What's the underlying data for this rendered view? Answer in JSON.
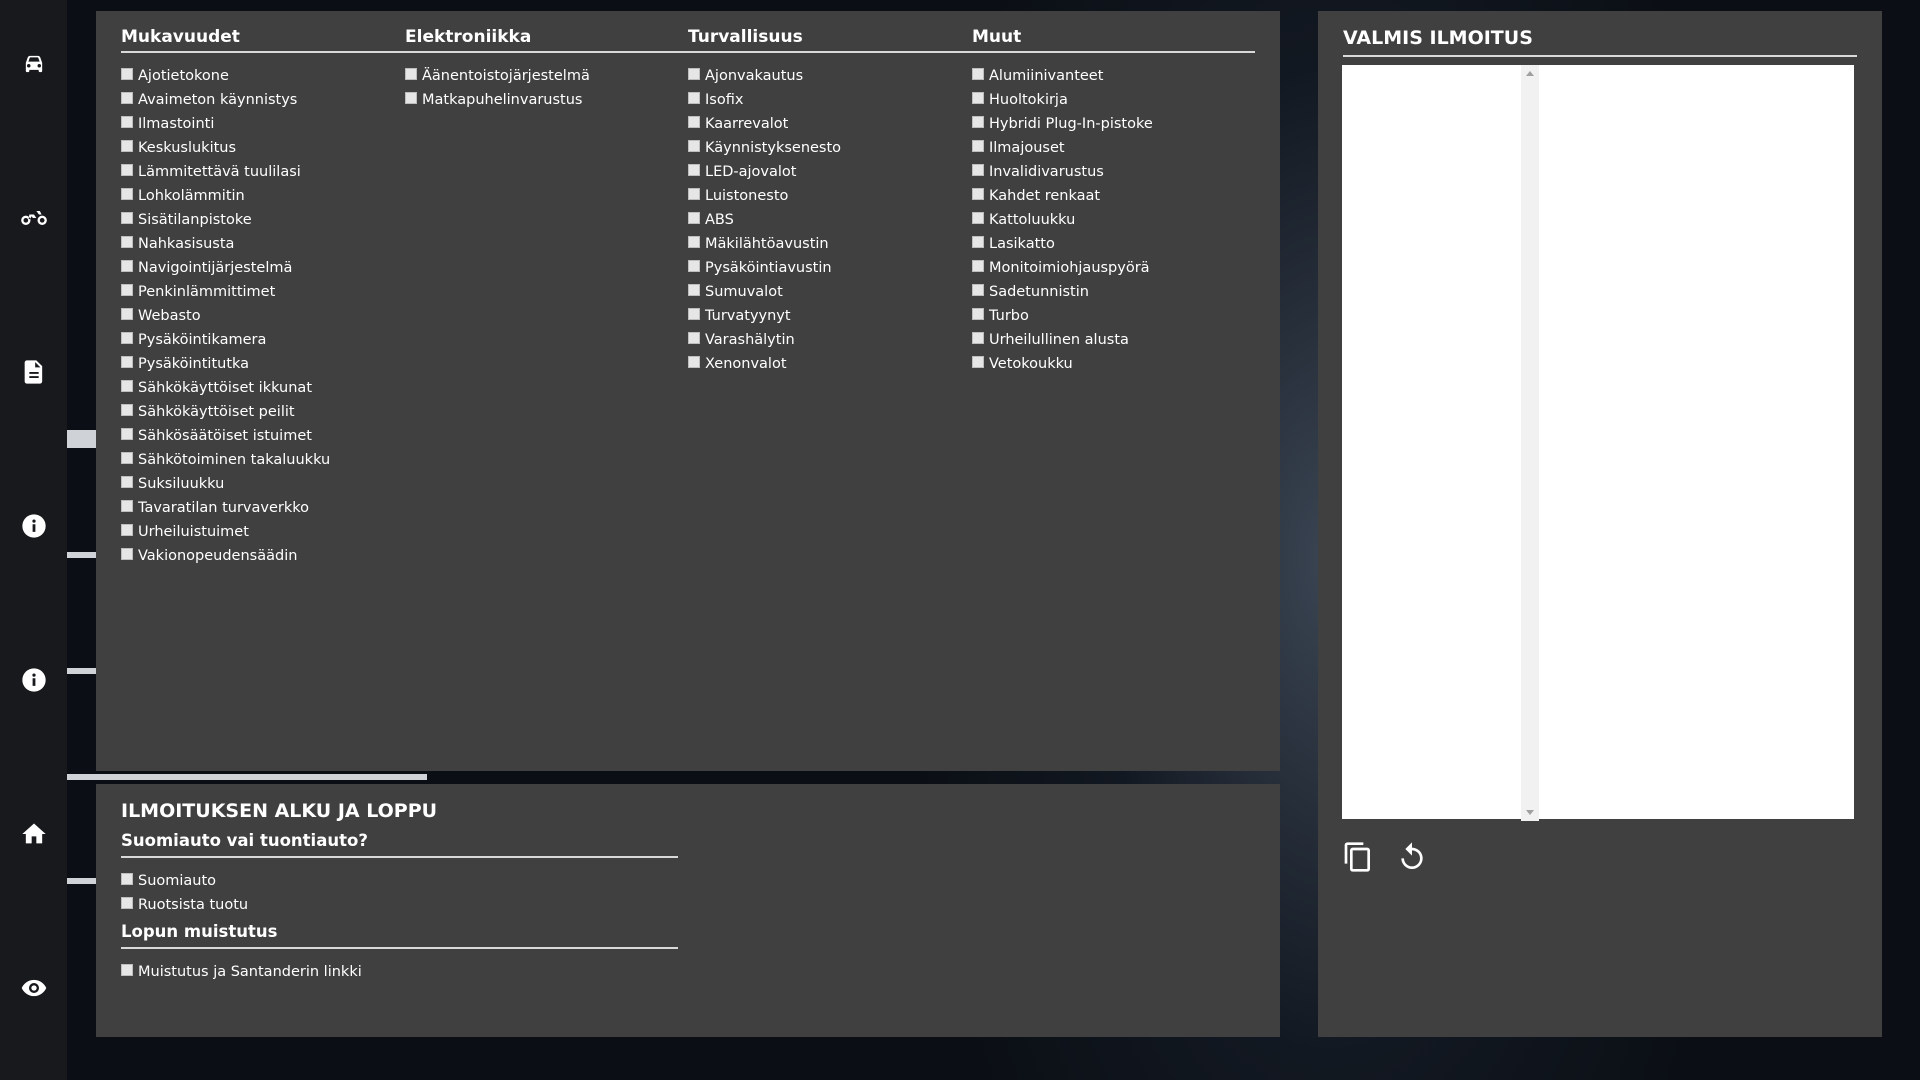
{
  "sidebar": {
    "items": [
      {
        "icon": "car-icon",
        "name": "car"
      },
      {
        "icon": "motorcycle-icon",
        "name": "motorcycle"
      },
      {
        "icon": "document-icon",
        "name": "document"
      },
      {
        "icon": "info-icon",
        "name": "info-1"
      },
      {
        "icon": "info-icon",
        "name": "info-2"
      },
      {
        "icon": "home-icon",
        "name": "home"
      },
      {
        "icon": "eye-icon",
        "name": "eye"
      }
    ]
  },
  "features": {
    "columns": [
      {
        "title": "Mukavuudet",
        "items": [
          "Ajotietokone",
          "Avaimeton käynnistys",
          "Ilmastointi",
          "Keskuslukitus",
          "Lämmitettävä tuulilasi",
          "Lohkolämmitin",
          "Sisätilanpistoke",
          "Nahkasisusta",
          "Navigointijärjestelmä",
          "Penkinlämmittimet",
          "Webasto",
          "Pysäköintikamera",
          "Pysäköintitutka",
          "Sähkökäyttöiset ikkunat",
          "Sähkökäyttöiset peilit",
          "Sähkösäätöiset istuimet",
          "Sähkötoiminen takaluukku",
          "Suksiluukku",
          "Tavaratilan turvaverkko",
          "Urheiluistuimet",
          "Vakionopeudensäädin"
        ]
      },
      {
        "title": "Elektroniikka",
        "items": [
          "Äänentoistojärjestelmä",
          "Matkapuhelinvarustus"
        ]
      },
      {
        "title": "Turvallisuus",
        "items": [
          "Ajonvakautus",
          "Isofix",
          "Kaarrevalot",
          "Käynnistyksenesto",
          "LED-ajovalot",
          "Luistonesto",
          "ABS",
          "Mäkilähtöavustin",
          "Pysäköintiavustin",
          "Sumuvalot",
          "Turvatyynyt",
          "Varashälytin",
          "Xenonvalot"
        ]
      },
      {
        "title": "Muut",
        "items": [
          "Alumiinivanteet",
          "Huoltokirja",
          "Hybridi Plug-In-pistoke",
          "Ilmajouset",
          "Invalidivarustus",
          "Kahdet renkaat",
          "Kattoluukku",
          "Lasikatto",
          "Monitoimiohjauspyörä",
          "Sadetunnistin",
          "Turbo",
          "Urheilullinen alusta",
          "Vetokoukku"
        ]
      }
    ]
  },
  "startend": {
    "title": "ILMOITUKSEN ALKU JA LOPPU",
    "groups": [
      {
        "title": "Suomiauto vai tuontiauto?",
        "items": [
          "Suomiauto",
          "Ruotsista tuotu"
        ]
      },
      {
        "title": "Lopun muistutus",
        "items": [
          "Muistutus ja Santanderin linkki"
        ]
      }
    ]
  },
  "result": {
    "title": "VALMIS ILMOITUS",
    "text": "",
    "actions": [
      {
        "icon": "copy-icon",
        "name": "copy-button"
      },
      {
        "icon": "reset-icon",
        "name": "reset-button"
      }
    ]
  },
  "colors": {
    "panel": "#404040",
    "rail": "#17191c",
    "text": "#ffffff"
  }
}
